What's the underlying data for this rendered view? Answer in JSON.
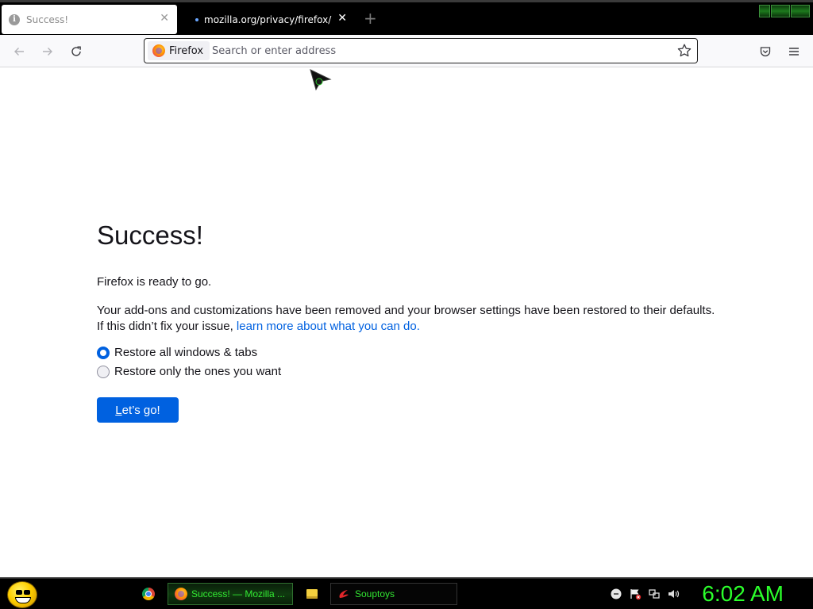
{
  "window": {
    "tabs": [
      {
        "title": "Success!",
        "active": true
      },
      {
        "title": "mozilla.org/privacy/firefox/",
        "active": false
      }
    ]
  },
  "navbar": {
    "identity_label": "Firefox",
    "url_placeholder": "Search or enter address",
    "url_value": ""
  },
  "page": {
    "title": "Success!",
    "ready_text": "Firefox is ready to go.",
    "description": "Your add-ons and customizations have been removed and your browser settings have been restored to their defaults.",
    "help_prefix": "If this didn’t fix your issue, ",
    "help_link": "learn more about what you can do.",
    "restore_options": [
      {
        "label": "Restore all windows & tabs",
        "checked": true
      },
      {
        "label": "Restore only the ones you want",
        "checked": false
      }
    ],
    "button_access_key": "L",
    "button_rest": "et’s go!"
  },
  "taskbar": {
    "tasks": [
      {
        "label": "Success! — Mozilla ..."
      },
      {
        "label": "Souptoys"
      }
    ],
    "clock": "6:02 AM"
  },
  "colors": {
    "accent_blue": "#0061e0",
    "taskbar_green": "#32e632",
    "clock_green": "#2bff2b"
  }
}
